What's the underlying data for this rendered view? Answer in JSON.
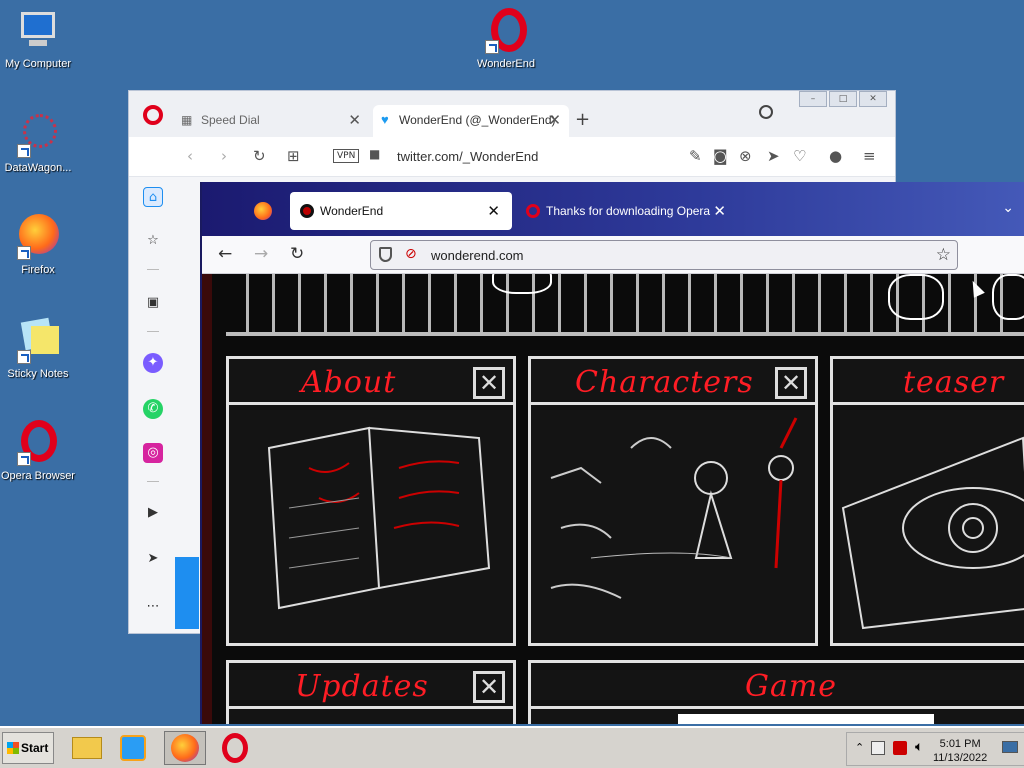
{
  "desktop": {
    "icons": [
      {
        "label": "My Computer"
      },
      {
        "label": "DataWagon..."
      },
      {
        "label": "Firefox"
      },
      {
        "label": "Sticky Notes"
      },
      {
        "label": "Opera Browser"
      },
      {
        "label": "WonderEnd"
      }
    ]
  },
  "opera": {
    "tabs": [
      {
        "label": "Speed Dial",
        "close": "✕"
      },
      {
        "label": "WonderEnd (@_WonderEnd)",
        "close": "✕"
      }
    ],
    "new_tab": "+",
    "vpn": "VPN",
    "address": "twitter.com/_WonderEnd"
  },
  "firefox": {
    "tabs": [
      {
        "label": "WonderEnd",
        "close": "✕"
      },
      {
        "label": "Thanks for downloading Opera",
        "close": "✕"
      }
    ],
    "address": "wonderend.com"
  },
  "site": {
    "panels": [
      {
        "title": "About",
        "close": "✕"
      },
      {
        "title": "Characters",
        "close": "✕"
      },
      {
        "title": "teaser"
      },
      {
        "title": "Updates",
        "close": "✕"
      },
      {
        "title": "Game"
      }
    ]
  },
  "taskbar": {
    "start": "Start",
    "time": "5:01 PM",
    "date": "11/13/2022"
  },
  "colors": {
    "desktop": "#3a6ea5",
    "opera_red": "#e0001b",
    "site_title_red": "#ff1d25",
    "firefox_tabstrip": "#1b1a70"
  }
}
